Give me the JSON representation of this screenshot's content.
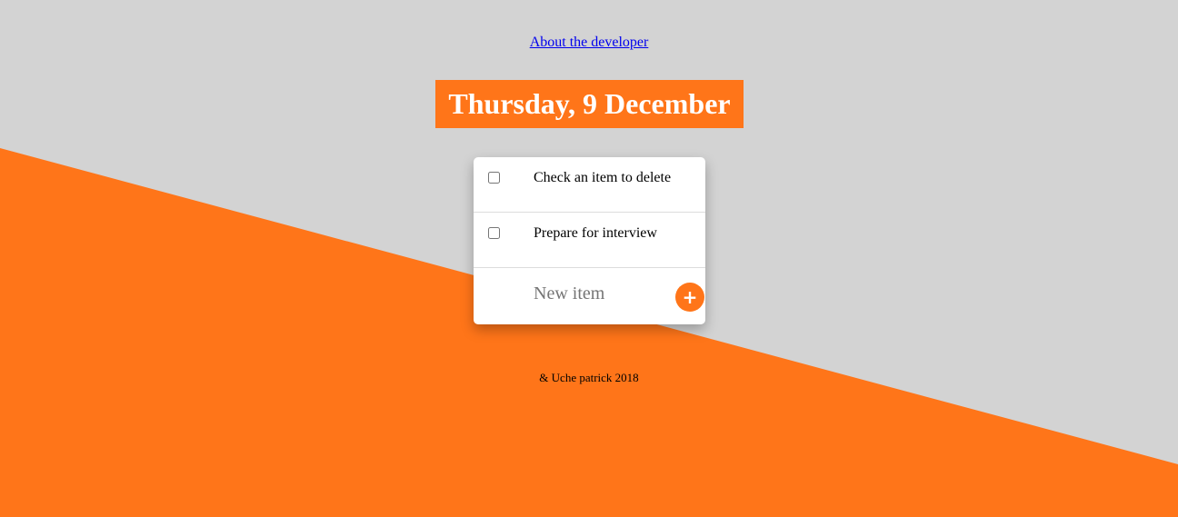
{
  "header": {
    "about_link": "About the developer"
  },
  "date_heading": "Thursday, 9 December",
  "todo": {
    "items": [
      {
        "label": "Check an item to delete",
        "checked": false
      },
      {
        "label": "Prepare for interview",
        "checked": false
      }
    ],
    "new_item_placeholder": "New item",
    "add_button_label": "+"
  },
  "footer": {
    "text": "& Uche patrick 2018"
  },
  "colors": {
    "background": "#d3d3d3",
    "accent": "#ff7519",
    "card": "#ffffff"
  }
}
